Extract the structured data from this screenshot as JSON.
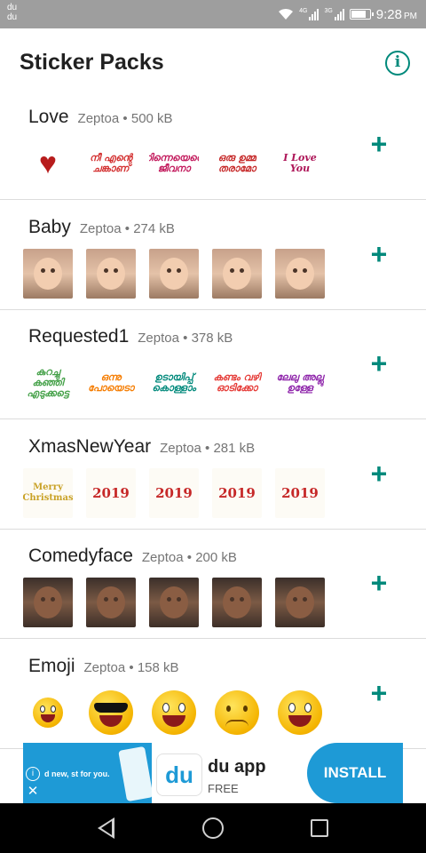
{
  "status_bar": {
    "carrier_line1": "du",
    "carrier_line2": "du",
    "signal1_label": "4G",
    "signal2_label": "3G",
    "battery_level_percent": 85,
    "time": "9:28",
    "ampm": "PM"
  },
  "header": {
    "title": "Sticker Packs",
    "info_icon": "info-icon"
  },
  "packs": [
    {
      "name": "Love",
      "publisher": "Zeptoa",
      "separator": "•",
      "size": "500 kB",
      "stickers": [
        {
          "kind": "silhouette",
          "text": "♥"
        },
        {
          "kind": "text",
          "text": "നീ എന്റെ ചങ്കാണ്",
          "color": "#d32f2f"
        },
        {
          "kind": "text",
          "text": "നിന്നെയെന്റെ ജീവനാ",
          "color": "#c2185b"
        },
        {
          "kind": "text",
          "text": "ഒരു ഉമ്മ തരാമോ",
          "color": "#c62828"
        },
        {
          "kind": "text",
          "text": "I Love You",
          "color": "#ad1457"
        }
      ]
    },
    {
      "name": "Baby",
      "publisher": "Zeptoa",
      "separator": "•",
      "size": "274 kB",
      "stickers": [
        {
          "kind": "photo"
        },
        {
          "kind": "photo"
        },
        {
          "kind": "photo"
        },
        {
          "kind": "photo"
        },
        {
          "kind": "photo"
        }
      ]
    },
    {
      "name": "Requested1",
      "publisher": "Zeptoa",
      "separator": "•",
      "size": "378 kB",
      "stickers": [
        {
          "kind": "text",
          "text": "കുറച്ചു കഞ്ഞി എടുക്കട്ടെ",
          "color": "#43a047"
        },
        {
          "kind": "text",
          "text": "ഒന്നു പോയെടാ",
          "color": "#f57c00"
        },
        {
          "kind": "text",
          "text": "ഉടായിപ്പ് കൊള്ളാം",
          "color": "#00897b"
        },
        {
          "kind": "text",
          "text": "കണ്ടം വഴി ഓടിക്കോ",
          "color": "#e53935"
        },
        {
          "kind": "text",
          "text": "ലേലു അല്ലു ഉള്ളേ",
          "color": "#8e24aa"
        }
      ]
    },
    {
      "name": "XmasNewYear",
      "publisher": "Zeptoa",
      "separator": "•",
      "size": "281 kB",
      "stickers": [
        {
          "kind": "xmas",
          "text": "Merry Christmas"
        },
        {
          "kind": "xmas",
          "text": "2019"
        },
        {
          "kind": "xmas",
          "text": "2019"
        },
        {
          "kind": "xmas",
          "text": "2019"
        },
        {
          "kind": "xmas",
          "text": "2019"
        }
      ]
    },
    {
      "name": "Comedyface",
      "publisher": "Zeptoa",
      "separator": "•",
      "size": "200 kB",
      "stickers": [
        {
          "kind": "darkphoto"
        },
        {
          "kind": "darkphoto"
        },
        {
          "kind": "darkphoto"
        },
        {
          "kind": "darkphoto"
        },
        {
          "kind": "darkphoto"
        }
      ]
    },
    {
      "name": "Emoji",
      "publisher": "Zeptoa",
      "separator": "•",
      "size": "158 kB",
      "stickers": [
        {
          "kind": "emoji-small"
        },
        {
          "kind": "emoji-shades"
        },
        {
          "kind": "emoji-smile"
        },
        {
          "kind": "emoji-sad"
        },
        {
          "kind": "emoji-smile"
        }
      ]
    }
  ],
  "add_icon": "plus-icon",
  "add_symbol": "+",
  "ad": {
    "image_text": "d new, st for you.",
    "logo_text": "du",
    "app_name": "du app",
    "price": "FREE",
    "install_label": "INSTALL",
    "info_symbol": "i",
    "close_symbol": "✕"
  },
  "nav_bar": {
    "icons": [
      "back-icon",
      "home-icon",
      "recents-icon"
    ]
  },
  "colors": {
    "accent": "#00897b",
    "ad_blue": "#1e9ad6"
  }
}
